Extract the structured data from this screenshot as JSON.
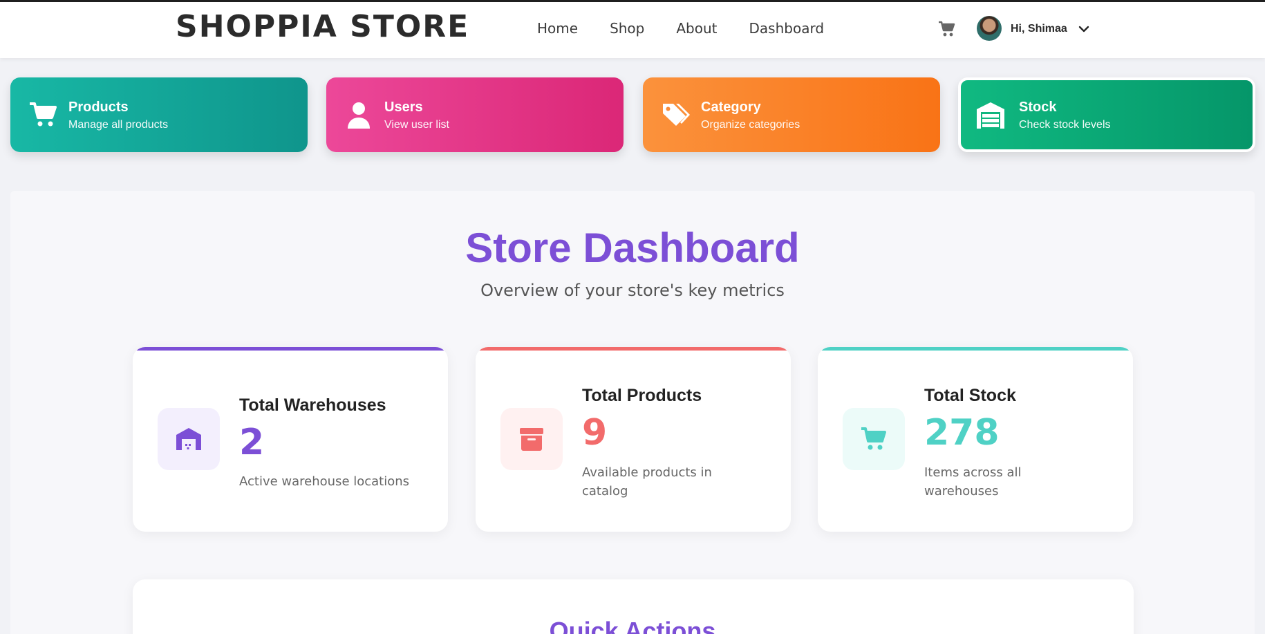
{
  "navbar": {
    "brand": "SHOPPIA STORE",
    "links": [
      "Home",
      "Shop",
      "About",
      "Dashboard"
    ],
    "greeting": "Hi, Shimaa"
  },
  "quick_cards": [
    {
      "title": "Products",
      "subtitle": "Manage all products",
      "icon": "cart-icon"
    },
    {
      "title": "Users",
      "subtitle": "View user list",
      "icon": "user-icon"
    },
    {
      "title": "Category",
      "subtitle": "Organize categories",
      "icon": "tags-icon"
    },
    {
      "title": "Stock",
      "subtitle": "Check stock levels",
      "icon": "warehouse-icon"
    }
  ],
  "dashboard": {
    "title": "Store Dashboard",
    "subtitle": "Overview of your store's key metrics"
  },
  "stats": [
    {
      "title": "Total Warehouses",
      "value": "2",
      "description": "Active warehouse locations",
      "color": "#7c4fd6",
      "icon": "warehouse-icon"
    },
    {
      "title": "Total Products",
      "value": "9",
      "description": "Available products in catalog",
      "color": "#f26b6b",
      "icon": "archive-icon"
    },
    {
      "title": "Total Stock",
      "value": "278",
      "description": "Items across all warehouses",
      "color": "#4fd1c5",
      "icon": "cart-icon"
    }
  ],
  "quick_actions": {
    "title": "Quick Actions"
  }
}
